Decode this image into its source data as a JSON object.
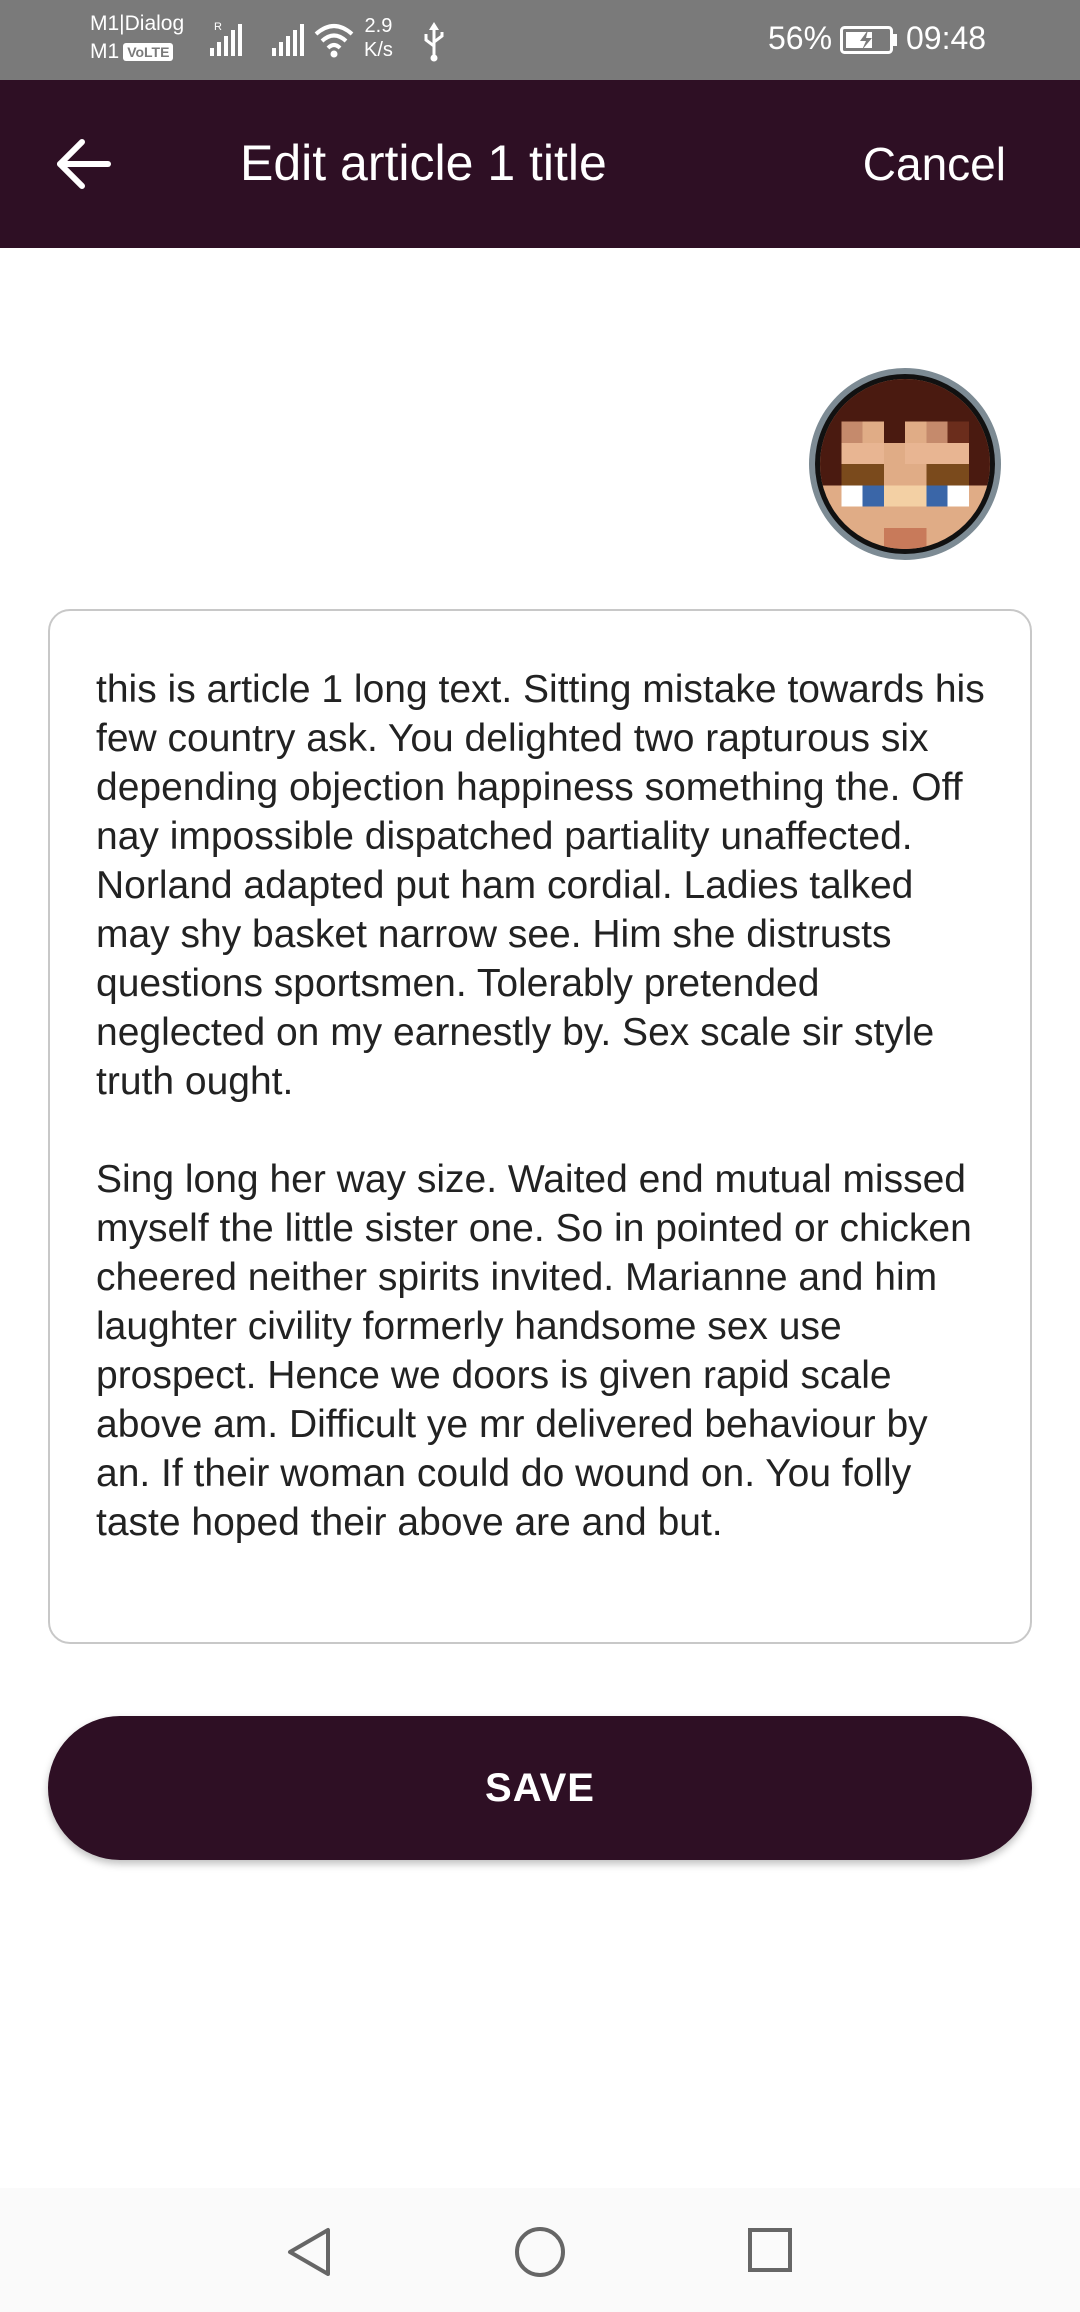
{
  "status_bar": {
    "carrier_line1": "M1|Dialog",
    "carrier_line2": "M1",
    "volte_badge": "VoLTE",
    "roaming_marker": "R",
    "net_speed_value": "2.9",
    "net_speed_unit": "K/s",
    "battery_percent": "56%",
    "time": "09:48",
    "icons": [
      "signal-icon",
      "signal-icon",
      "wifi-icon",
      "usb-icon",
      "battery-charging-icon"
    ]
  },
  "app_bar": {
    "title": "Edit article 1 title",
    "cancel_label": "Cancel",
    "back_icon": "arrow-left-icon",
    "background": "#2e0f24"
  },
  "avatar": {
    "icon": "pixel-face-avatar"
  },
  "editor": {
    "paragraph1": "this is article 1 long text. Sitting mistake towards his few country ask. You delighted two rapturous six depending objection happiness something the. Off nay impossible dispatched partiality unaffected. Norland adapted put ham cordial. Ladies talked may shy basket narrow see. Him she distrusts questions sportsmen. Tolerably pretended neglected on my earnestly by. Sex scale sir style truth ought.",
    "paragraph2": "Sing long her way size. Waited end mutual missed myself the little sister one. So in pointed or chicken cheered neither spirits invited. Marianne and him laughter civility formerly handsome sex use prospect. Hence we doors is given rapid scale above am. Difficult ye mr delivered behaviour by an. If their woman could do wound on. You folly taste hoped their above are and but."
  },
  "save_button": {
    "label": "SAVE",
    "background": "#2e0f24"
  },
  "nav_bar": {
    "icons": [
      "nav-back-icon",
      "nav-home-icon",
      "nav-recents-icon"
    ]
  }
}
